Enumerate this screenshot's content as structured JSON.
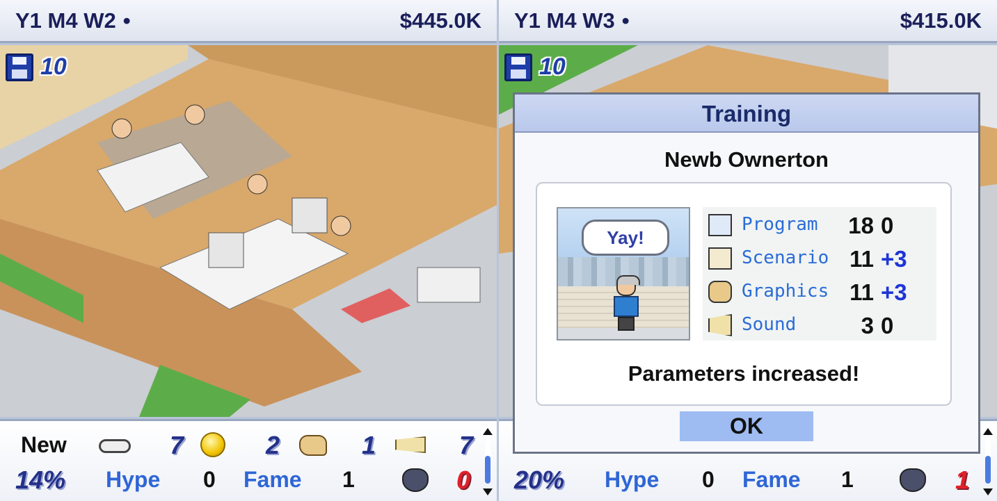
{
  "left": {
    "date": "Y1 M4 W2",
    "date_marker": "•",
    "money": "$445.0K",
    "saves": "10",
    "status": {
      "label_new": "New",
      "stat_pad": "7",
      "stat_coin": "2",
      "stat_graphics": "1",
      "stat_sound": "7",
      "progress": "14%",
      "hype_label": "Hype",
      "hype_value": "0",
      "fame_label": "Fame",
      "fame_value": "1",
      "bugs": "0"
    }
  },
  "right": {
    "date": "Y1 M4 W3",
    "date_marker": "•",
    "money": "$415.0K",
    "saves": "10",
    "status": {
      "progress": "20%",
      "hype_label": "Hype",
      "hype_value": "0",
      "fame_label": "Fame",
      "fame_value": "1",
      "bugs": "1"
    },
    "dialog": {
      "title": "Training",
      "employee": "Newb Ownerton",
      "speech": "Yay!",
      "params": [
        {
          "icon": "computer-icon",
          "name": "Program",
          "value": "18",
          "inc": "0"
        },
        {
          "icon": "book-icon",
          "name": "Scenario",
          "value": "11",
          "inc": "+3"
        },
        {
          "icon": "palette-icon",
          "name": "Graphics",
          "value": "11",
          "inc": "+3"
        },
        {
          "icon": "horn-icon",
          "name": "Sound",
          "value": "3",
          "inc": "0"
        }
      ],
      "message": "Parameters increased!",
      "ok_label": "OK"
    }
  },
  "colors": {
    "accent_blue": "#2f66d6",
    "title_navy": "#1a1f5a",
    "increase_blue": "#1f35d6",
    "bug_red": "#e0202a"
  }
}
